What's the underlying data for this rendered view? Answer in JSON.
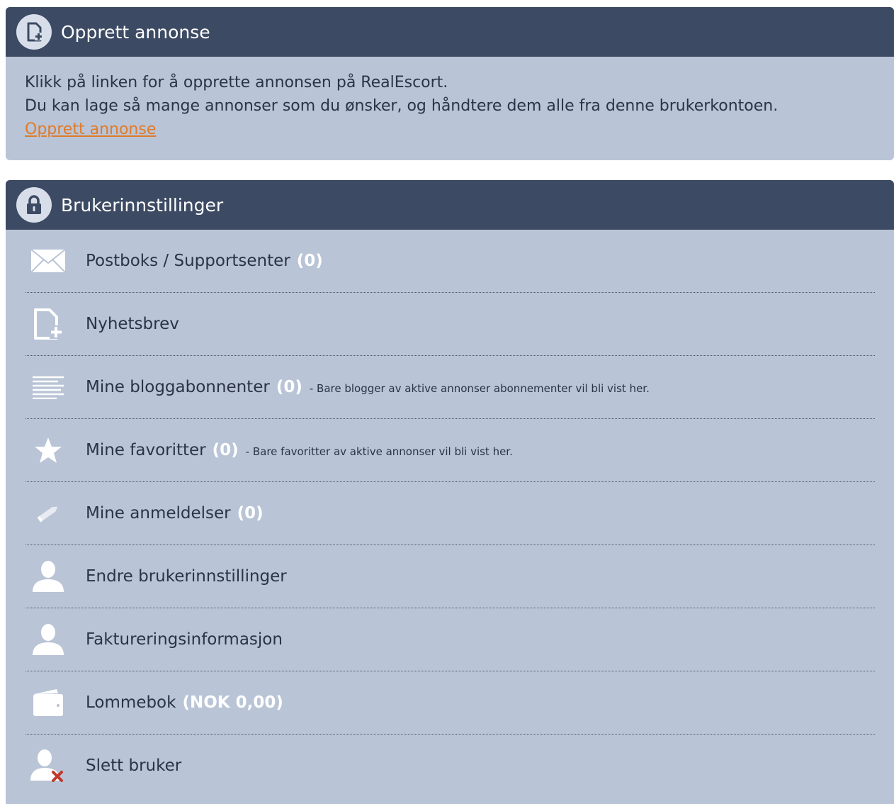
{
  "create_ad": {
    "title": "Opprett annonse",
    "icon": "document-add-icon",
    "text_line1": "Klikk på linken for å opprette annonsen på RealEscort.",
    "text_line2": "Du kan lage så mange annonser som du ønsker, og håndtere dem alle fra denne brukerkontoen.",
    "link_label": "Opprett annonse"
  },
  "settings": {
    "title": "Brukerinnstillinger",
    "icon": "lock-icon",
    "items": [
      {
        "label": "Postboks / Supportsenter",
        "count": "(0)",
        "note": "",
        "icon": "envelope-icon"
      },
      {
        "label": "Nyhetsbrev",
        "count": "",
        "note": "",
        "icon": "document-add-icon"
      },
      {
        "label": "Mine bloggabonnenter",
        "count": "(0)",
        "note": "- Bare blogger av aktive annonser abonnementer vil bli vist her.",
        "icon": "text-lines-icon"
      },
      {
        "label": "Mine favoritter",
        "count": "(0)",
        "note": "- Bare favoritter av aktive annonser vil bli vist her.",
        "icon": "star-icon"
      },
      {
        "label": "Mine anmeldelser",
        "count": "(0)",
        "note": "",
        "icon": "pencil-icon"
      },
      {
        "label": "Endre brukerinnstillinger",
        "count": "",
        "note": "",
        "icon": "user-icon"
      },
      {
        "label": "Faktureringsinformasjon",
        "count": "",
        "note": "",
        "icon": "user-icon"
      },
      {
        "label": "Lommebok",
        "count": "(NOK 0,00)",
        "note": "",
        "icon": "wallet-icon"
      },
      {
        "label": "Slett bruker",
        "count": "",
        "note": "",
        "icon": "user-delete-icon"
      }
    ]
  },
  "colors": {
    "header_bg": "#3c4a63",
    "panel_bg": "#b9c4d6",
    "link": "#e07b2a",
    "delete_x": "#c0392b"
  }
}
